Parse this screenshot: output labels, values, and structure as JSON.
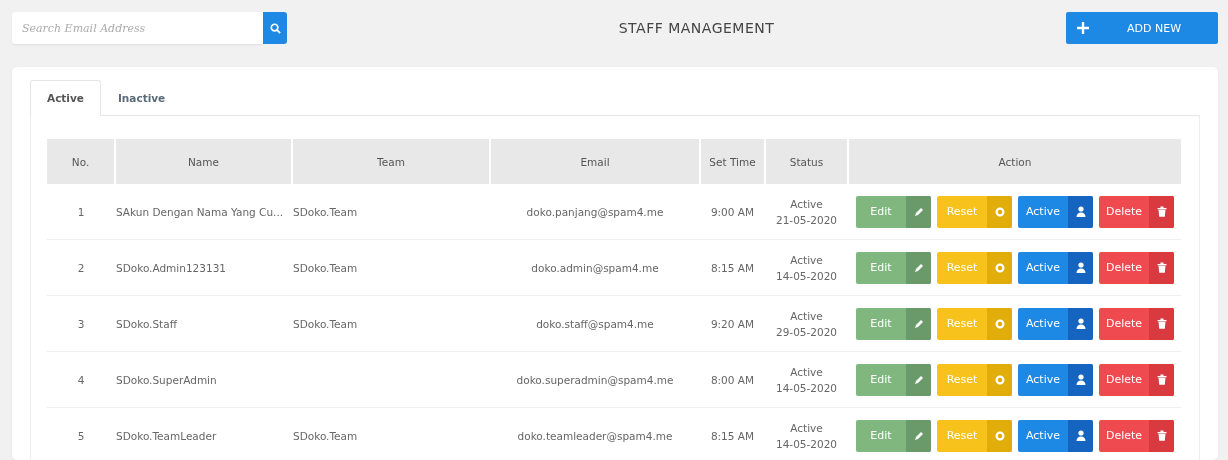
{
  "search": {
    "placeholder": "Search Email Address"
  },
  "title": "STAFF MANAGEMENT",
  "add_button": {
    "label": "ADD NEW"
  },
  "tabs": [
    {
      "label": "Active",
      "selected": true
    },
    {
      "label": "Inactive",
      "selected": false
    }
  ],
  "table": {
    "columns": [
      "No.",
      "Name",
      "Team",
      "Email",
      "Set Time",
      "Status",
      "Action"
    ],
    "rows": [
      {
        "no": "1",
        "name": "SAkun Dengan Nama Yang Cu...",
        "team": "SDoko.Team",
        "email": "doko.panjang@spam4.me",
        "set_time": "9:00 AM",
        "status": "Active",
        "date": "21-05-2020",
        "actions": [
          {
            "kind": "edit",
            "label": "Edit"
          },
          {
            "kind": "reset",
            "label": "Reset"
          },
          {
            "kind": "activate",
            "label": "Active"
          },
          {
            "kind": "delete",
            "label": "Delete"
          }
        ]
      },
      {
        "no": "2",
        "name": "SDoko.Admin123131",
        "team": "SDoko.Team",
        "email": "doko.admin@spam4.me",
        "set_time": "8:15 AM",
        "status": "Active",
        "date": "14-05-2020",
        "actions": [
          {
            "kind": "edit",
            "label": "Edit"
          },
          {
            "kind": "reset",
            "label": "Reset"
          },
          {
            "kind": "activate",
            "label": "Active"
          },
          {
            "kind": "delete",
            "label": "Delete"
          }
        ]
      },
      {
        "no": "3",
        "name": "SDoko.Staff",
        "team": "SDoko.Team",
        "email": "doko.staff@spam4.me",
        "set_time": "9:20 AM",
        "status": "Active",
        "date": "29-05-2020",
        "actions": [
          {
            "kind": "edit",
            "label": "Edit"
          },
          {
            "kind": "reset",
            "label": "Reset"
          },
          {
            "kind": "activate",
            "label": "Active"
          },
          {
            "kind": "delete",
            "label": "Delete"
          }
        ]
      },
      {
        "no": "4",
        "name": "SDoko.SuperAdmin",
        "email": "doko.superadmin@spam4.me",
        "set_time": "8:00 AM",
        "status": "Active",
        "date": "14-05-2020",
        "actions": [
          {
            "kind": "edit",
            "label": "Edit"
          },
          {
            "kind": "reset",
            "label": "Reset"
          },
          {
            "kind": "activate",
            "label": "Active"
          },
          {
            "kind": "delete",
            "label": "Delete"
          }
        ]
      },
      {
        "no": "5",
        "name": "SDoko.TeamLeader",
        "team": "SDoko.Team",
        "email": "doko.teamleader@spam4.me",
        "set_time": "8:15 AM",
        "status": "Active",
        "date": "14-05-2020",
        "actions": [
          {
            "kind": "edit",
            "label": "Edit"
          },
          {
            "kind": "reset",
            "label": "Reset"
          },
          {
            "kind": "activate",
            "label": "Active"
          },
          {
            "kind": "delete",
            "label": "Delete"
          }
        ]
      }
    ]
  }
}
